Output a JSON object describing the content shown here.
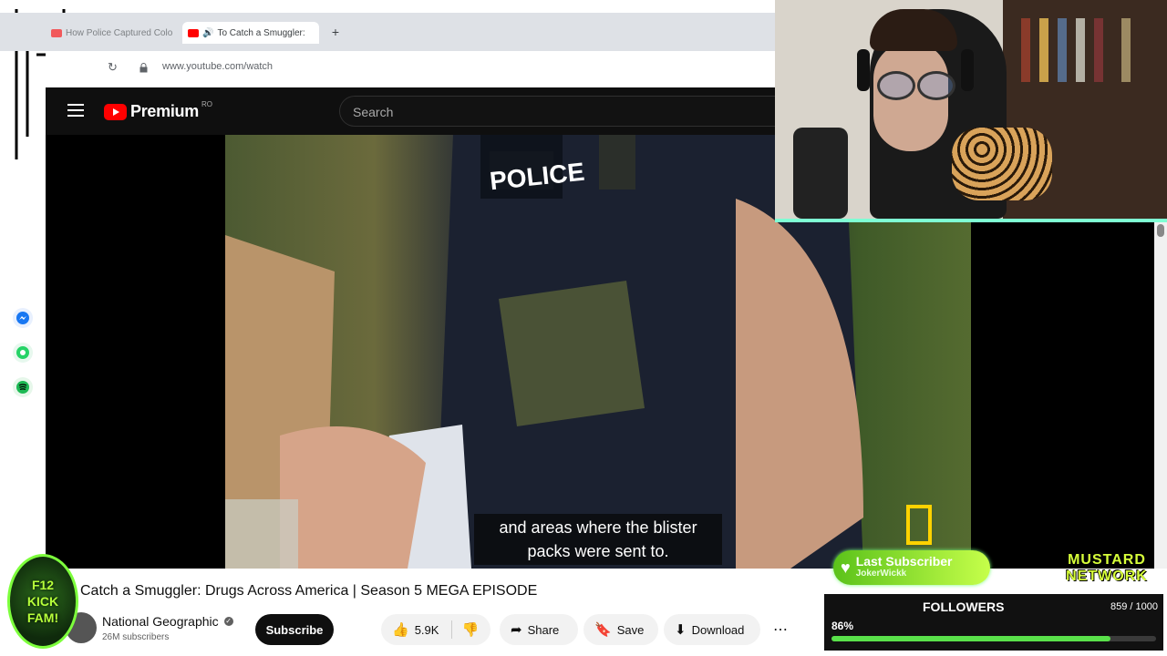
{
  "browser": {
    "tabs": [
      {
        "label": "How Police Captured Colo"
      },
      {
        "label": "To Catch a Smuggler: "
      }
    ],
    "new_tab": "+",
    "url": "www.youtube.com/watch"
  },
  "youtube": {
    "logo_word": "Premium",
    "logo_country": "RO",
    "search_placeholder": "Search"
  },
  "video": {
    "caption_line1": "and areas where the blister",
    "caption_line2": "packs were sent to.",
    "title": "Catch a Smuggler: Drugs Across America | Season 5 MEGA EPISODE",
    "channel": "National Geographic",
    "subscribers": "26M subscribers",
    "subscribe_label": "Subscribe",
    "likes": "5.9K",
    "share_label": "Share",
    "save_label": "Save",
    "download_label": "Download",
    "more_label": "⋯"
  },
  "overlay": {
    "kick_line1": "F12",
    "kick_line2": "KICK FAM!",
    "last_subscriber_label": "Last Subscriber",
    "last_subscriber_name": "JokerWickk",
    "mustard_line1": "MUSTARD",
    "mustard_line2": "NETWORK",
    "followers_label": "FOLLOWERS",
    "followers_count": "859 / 1000",
    "followers_pct_text": "86%",
    "followers_progress": 0.86
  },
  "colors": {
    "youtube_red": "#ff0000",
    "overlay_green": "#59e04a",
    "accent_lime": "#d7ff3a"
  }
}
